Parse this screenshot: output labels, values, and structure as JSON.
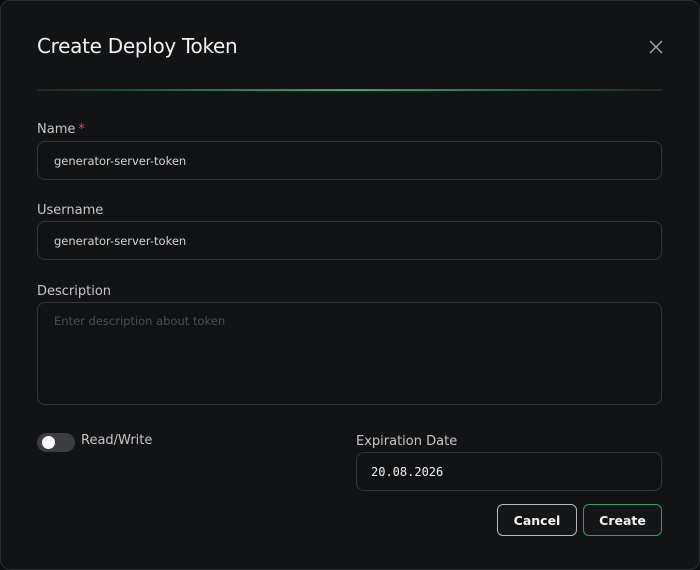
{
  "dialog": {
    "title": "Create Deploy Token"
  },
  "fields": {
    "name": {
      "label": "Name",
      "required_mark": "*",
      "value": "generator-server-token"
    },
    "username": {
      "label": "Username",
      "value": "generator-server-token"
    },
    "description": {
      "label": "Description",
      "placeholder": "Enter description about token",
      "value": ""
    },
    "read_write": {
      "label": "Read/Write",
      "enabled": false
    },
    "expiration": {
      "label": "Expiration Date",
      "value": "20.08.2026"
    }
  },
  "buttons": {
    "cancel": "Cancel",
    "create": "Create"
  },
  "colors": {
    "accent": "#2f9e64",
    "required": "#e5484d",
    "background": "#121315"
  }
}
